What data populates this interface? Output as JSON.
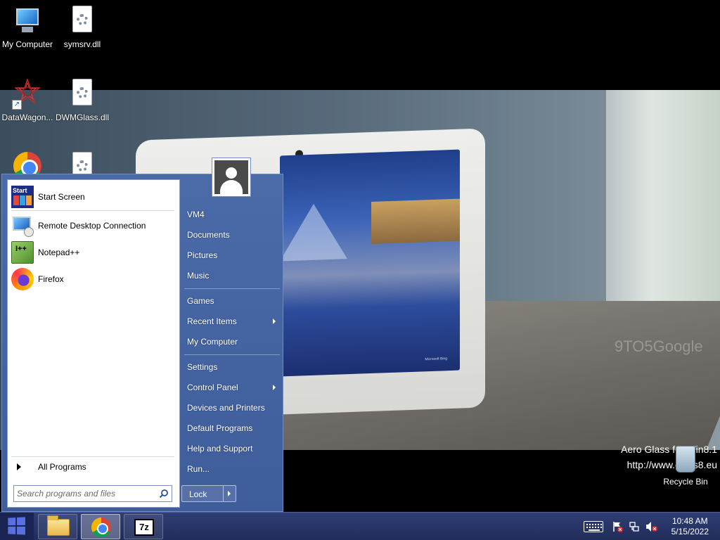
{
  "desktop": {
    "icons": [
      {
        "label": "My Computer",
        "icon": "my-computer-icon"
      },
      {
        "label": "symsrv.dll",
        "icon": "dll-file-icon"
      },
      {
        "label": "DataWagon...",
        "icon": "datawagon-shortcut-icon"
      },
      {
        "label": "DWMGlass.dll",
        "icon": "dll-file-icon"
      },
      {
        "label": "",
        "icon": "chrome-icon"
      },
      {
        "label": "",
        "icon": "dll-file-icon"
      }
    ],
    "watermark": "9TO5Google",
    "aero_title": "Aero Glass for Win8.1",
    "aero_url": "http://www.glass8.eu",
    "recycle_bin": "Recycle Bin",
    "wallpaper_credit": "Microsoft Bing"
  },
  "start_menu": {
    "pinned": [
      {
        "label": "Start Screen",
        "icon": "start-screen-icon"
      },
      {
        "label": "Remote Desktop Connection",
        "icon": "remote-desktop-icon"
      },
      {
        "label": "Notepad++",
        "icon": "notepad-plus-plus-icon"
      },
      {
        "label": "Firefox",
        "icon": "firefox-icon"
      }
    ],
    "all_programs": "All Programs",
    "search_placeholder": "Search programs and files",
    "right_items": [
      {
        "label": "VM4",
        "has_submenu": false
      },
      {
        "label": "Documents",
        "has_submenu": false
      },
      {
        "label": "Pictures",
        "has_submenu": false
      },
      {
        "label": "Music",
        "has_submenu": false
      },
      {
        "label": "Games",
        "has_submenu": false
      },
      {
        "label": "Recent Items",
        "has_submenu": true
      },
      {
        "label": "My Computer",
        "has_submenu": false
      },
      {
        "label": "Settings",
        "has_submenu": false
      },
      {
        "label": "Control Panel",
        "has_submenu": true
      },
      {
        "label": "Devices and Printers",
        "has_submenu": false
      },
      {
        "label": "Default Programs",
        "has_submenu": false
      },
      {
        "label": "Help and Support",
        "has_submenu": false
      },
      {
        "label": "Run...",
        "has_submenu": false
      }
    ],
    "lock_label": "Lock"
  },
  "taskbar": {
    "apps": [
      {
        "name": "File Explorer",
        "icon": "folder-icon",
        "active": false
      },
      {
        "name": "Google Chrome",
        "icon": "chrome-icon",
        "active": true
      },
      {
        "name": "7-Zip",
        "icon": "7zip-icon",
        "active": false,
        "glyph": "7z"
      }
    ],
    "clock": {
      "time": "10:48 AM",
      "date": "5/15/2022"
    }
  },
  "colors": {
    "taskbar": "#2f3e74",
    "start_menu": "#4a6aa8",
    "windows_logo": "#5a6fe0"
  }
}
